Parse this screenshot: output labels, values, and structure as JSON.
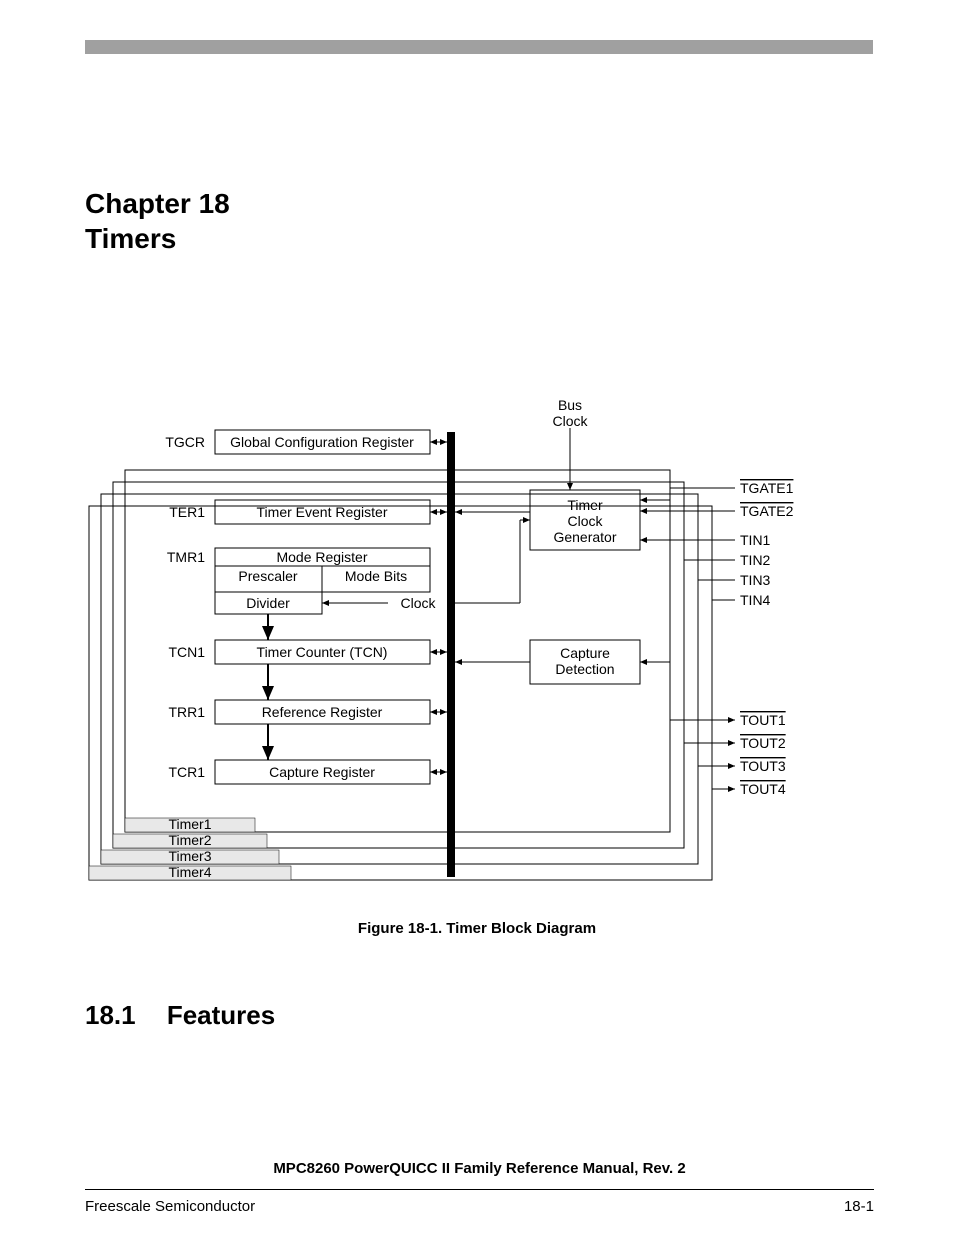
{
  "header": {
    "chapter_line1": "Chapter 18",
    "chapter_line2": "Timers"
  },
  "figure": {
    "caption": "Figure 18-1. Timer Block Diagram",
    "labels": {
      "tgcr": "TGCR",
      "ter1": "TER1",
      "tmr1": "TMR1",
      "tcn1": "TCN1",
      "trr1": "TRR1",
      "tcr1": "TCR1",
      "gcr": "Global Configuration Register",
      "ter": "Timer Event Register",
      "mode_reg": "Mode Register",
      "prescaler": "Prescaler",
      "mode_bits": "Mode Bits",
      "divider": "Divider",
      "clock": "Clock",
      "tcn": "Timer Counter (TCN)",
      "ref_reg": "Reference Register",
      "cap_reg": "Capture Register",
      "bus": "Bus",
      "bus_clock": "Clock",
      "timer_clock_gen_l1": "Timer",
      "timer_clock_gen_l2": "Clock",
      "timer_clock_gen_l3": "Generator",
      "capture_l1": "Capture",
      "capture_l2": "Detection",
      "timer1": "Timer1",
      "timer2": "Timer2",
      "timer3": "Timer3",
      "timer4": "Timer4"
    },
    "pins": {
      "tgate1": "TGATE1",
      "tgate2": "TGATE2",
      "tin1": "TIN1",
      "tin2": "TIN2",
      "tin3": "TIN3",
      "tin4": "TIN4",
      "tout1": "TOUT1",
      "tout2": "TOUT2",
      "tout3": "TOUT3",
      "tout4": "TOUT4"
    }
  },
  "section": {
    "number": "18.1",
    "title": "Features"
  },
  "footer": {
    "center": "MPC8260 PowerQUICC II Family Reference Manual, Rev. 2",
    "left": "Freescale Semiconductor",
    "right": "18-1"
  }
}
